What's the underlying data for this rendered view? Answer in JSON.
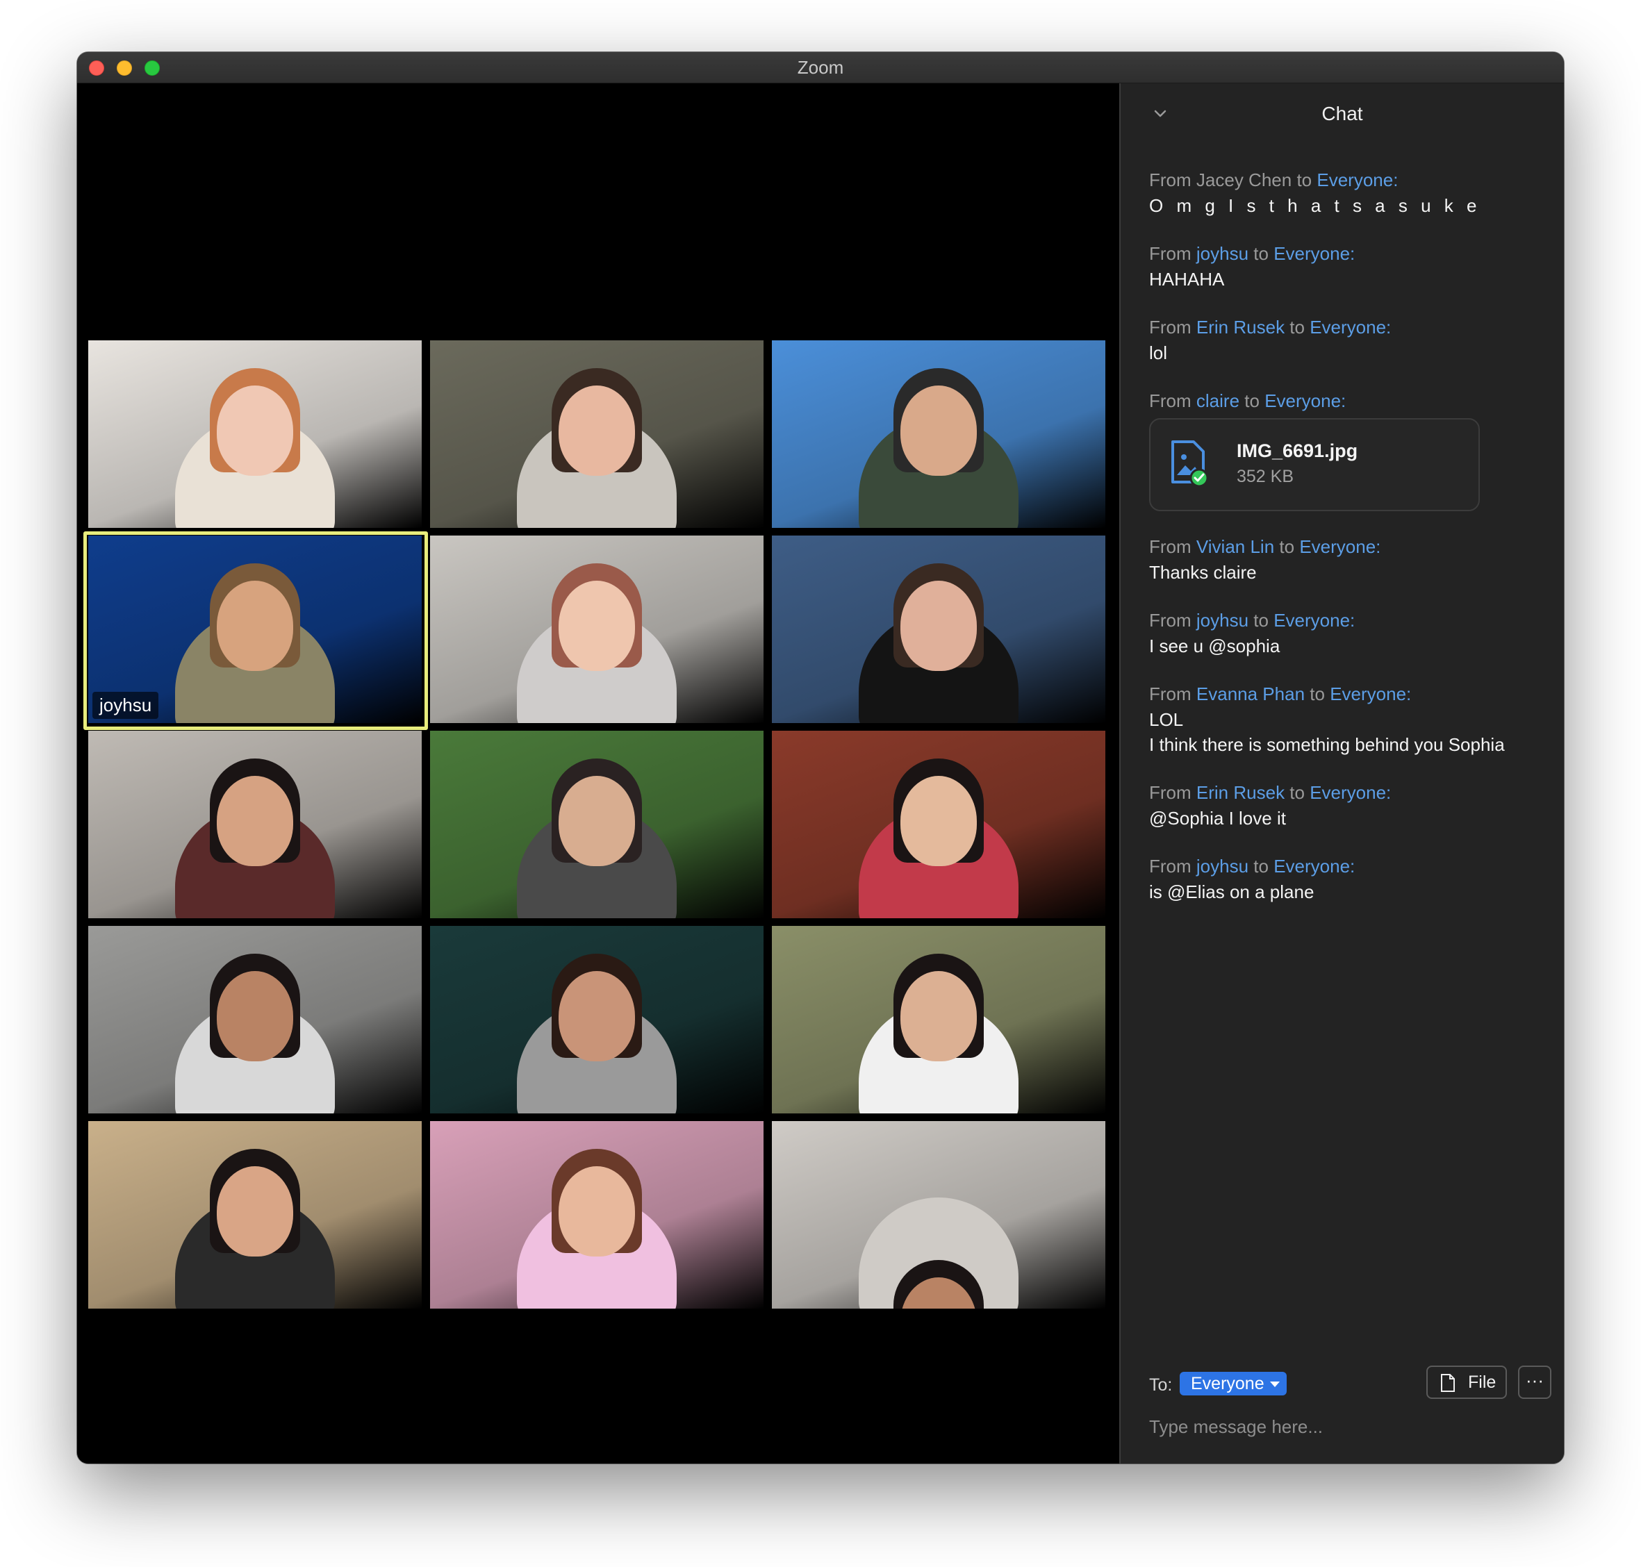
{
  "window": {
    "title": "Zoom"
  },
  "gallery": {
    "tiles": [
      {
        "name": "",
        "bg": "#e8e4df",
        "skin": "#f0c8b4",
        "hair": "#c87a4a",
        "shirt": "#e9e1d6"
      },
      {
        "name": "",
        "bg": "#6b6a5c",
        "skin": "#e8b8a0",
        "hair": "#3a2a22",
        "shirt": "#c9c5be"
      },
      {
        "name": "",
        "bg": "#4b8fd9",
        "skin": "#d9a98a",
        "hair": "#2a2a2a",
        "shirt": "#3a4a3a"
      },
      {
        "name": "joyhsu",
        "bg": "#0f3d8c",
        "skin": "#d7a37e",
        "hair": "#7a5a3a",
        "shirt": "#8a8466"
      },
      {
        "name": "",
        "bg": "#c9c6c1",
        "skin": "#efc6ae",
        "hair": "#9a5a4a",
        "shirt": "#cfcccb"
      },
      {
        "name": "",
        "bg": "#3e5d86",
        "skin": "#e0b09a",
        "hair": "#3a2a22",
        "shirt": "#141414"
      },
      {
        "name": "",
        "bg": "#bfbab4",
        "skin": "#d6a282",
        "hair": "#1a1414",
        "shirt": "#5a2a2a"
      },
      {
        "name": "",
        "bg": "#4a7a3a",
        "skin": "#d8ad90",
        "hair": "#2a2222",
        "shirt": "#4a4a4a"
      },
      {
        "name": "",
        "bg": "#8a3a2a",
        "skin": "#e4ba9c",
        "hair": "#1a1414",
        "shirt": "#c23a4a"
      },
      {
        "name": "",
        "bg": "#9a9a98",
        "skin": "#b98364",
        "hair": "#1a1414",
        "shirt": "#d8d8d8"
      },
      {
        "name": "",
        "bg": "#1a3a3a",
        "skin": "#c99478",
        "hair": "#2a1a14",
        "shirt": "#9a9a9a"
      },
      {
        "name": "",
        "bg": "#8a8f68",
        "skin": "#dcb093",
        "hair": "#1a1414",
        "shirt": "#f0f0f0"
      },
      {
        "name": "",
        "bg": "#c9b08a",
        "skin": "#d9a586",
        "hair": "#1a1414",
        "shirt": "#2a2a2a"
      },
      {
        "name": "",
        "bg": "#d8a0b8",
        "skin": "#e8b89c",
        "hair": "#6a3a2a",
        "shirt": "#f0c0e0"
      },
      {
        "name": "",
        "bg": "#cfcbc6",
        "skin": "#b98364",
        "hair": "#1a1414",
        "shirt": "#cfcbc6"
      }
    ]
  },
  "chat": {
    "title": "Chat",
    "messages": [
      {
        "from_prefix": "From",
        "sender": "Jacey Chen",
        "sender_blue": false,
        "to_word": "to",
        "recipient": "Everyone:",
        "text": "O m g I s t h a t s a s u k e",
        "spaced": true
      },
      {
        "from_prefix": "From",
        "sender": "joyhsu",
        "sender_blue": true,
        "to_word": "to",
        "recipient": "Everyone:",
        "text": "HAHAHA"
      },
      {
        "from_prefix": "From",
        "sender": "Erin Rusek",
        "sender_blue": true,
        "to_word": "to",
        "recipient": "Everyone:",
        "text": "lol"
      },
      {
        "from_prefix": "From",
        "sender": "claire",
        "sender_blue": true,
        "to_word": "to",
        "recipient": "Everyone:",
        "file": {
          "name": "IMG_6691.jpg",
          "size": "352 KB"
        }
      },
      {
        "from_prefix": "From",
        "sender": "Vivian Lin",
        "sender_blue": true,
        "to_word": "to",
        "recipient": "Everyone:",
        "text": "Thanks claire"
      },
      {
        "from_prefix": "From",
        "sender": "joyhsu",
        "sender_blue": true,
        "to_word": "to",
        "recipient": "Everyone:",
        "text": "I see u @sophia"
      },
      {
        "from_prefix": "From",
        "sender": "Evanna Phan",
        "sender_blue": true,
        "to_word": "to",
        "recipient": "Everyone:",
        "text": "LOL",
        "text2": "I think there is something behind you Sophia"
      },
      {
        "from_prefix": "From",
        "sender": "Erin Rusek",
        "sender_blue": true,
        "to_word": "to",
        "recipient": "Everyone:",
        "text": "@Sophia I love it"
      },
      {
        "from_prefix": "From",
        "sender": "joyhsu",
        "sender_blue": true,
        "to_word": "to",
        "recipient": "Everyone:",
        "text": "is @Elias on a plane"
      }
    ],
    "compose": {
      "to_label": "To:",
      "to_value": "Everyone",
      "file_button": "File",
      "more_button": "···",
      "placeholder": "Type message here..."
    }
  },
  "colors": {
    "accent_blue": "#2d74e5",
    "link_blue": "#5c9ee6",
    "active_speaker_border": "#e8ed7d",
    "file_check_green": "#34c759"
  }
}
